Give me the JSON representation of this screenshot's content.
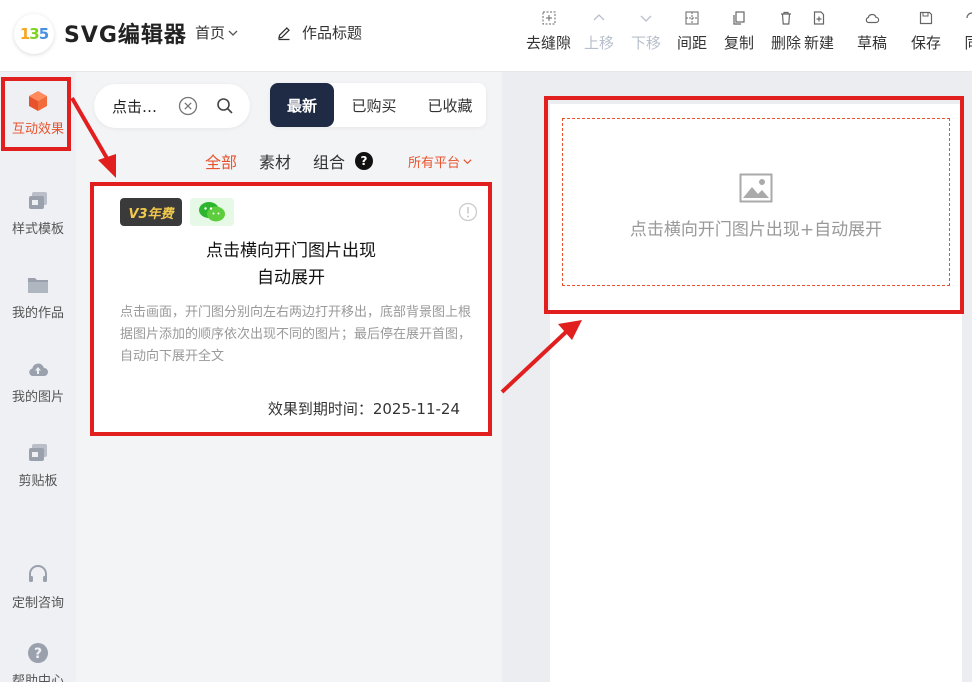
{
  "app": {
    "logo_text": "135",
    "title": "SVG编辑器",
    "home_menu": "首页",
    "work_title": "作品标题"
  },
  "toolbar": [
    {
      "label": "去缝隙",
      "icon": "seam-icon",
      "disabled": false
    },
    {
      "label": "上移",
      "icon": "chevron-up-icon",
      "disabled": true
    },
    {
      "label": "下移",
      "icon": "chevron-down-icon",
      "disabled": true
    },
    {
      "label": "间距",
      "icon": "spacing-icon",
      "disabled": false
    },
    {
      "label": "复制",
      "icon": "copy-icon",
      "disabled": false
    },
    {
      "label": "删除",
      "icon": "trash-icon",
      "disabled": false
    },
    {
      "label": "新建",
      "icon": "new-file-icon",
      "disabled": false
    },
    {
      "label": "草稿",
      "icon": "cloud-icon",
      "disabled": false
    },
    {
      "label": "保存",
      "icon": "save-icon",
      "disabled": false
    },
    {
      "label": "同",
      "icon": "sync-icon",
      "disabled": false
    }
  ],
  "sidebar": {
    "items": [
      {
        "label": "互动效果",
        "icon": "cube-icon",
        "active": true
      },
      {
        "label": "样式模板",
        "icon": "template-icon",
        "active": false
      },
      {
        "label": "我的作品",
        "icon": "folder-icon",
        "active": false
      },
      {
        "label": "我的图片",
        "icon": "cloud-upload-icon",
        "active": false
      },
      {
        "label": "剪贴板",
        "icon": "clipboard-icon",
        "active": false
      },
      {
        "label": "定制咨询",
        "icon": "headset-icon",
        "active": false
      },
      {
        "label": "帮助中心",
        "icon": "help-icon",
        "active": false
      }
    ]
  },
  "search": {
    "value": "点击…"
  },
  "tabs": [
    {
      "label": "最新",
      "active": true
    },
    {
      "label": "已购买",
      "active": false
    },
    {
      "label": "已收藏",
      "active": false
    }
  ],
  "filters": {
    "all": "全部",
    "material": "素材",
    "combo": "组合",
    "combo_help": "?",
    "platform": "所有平台"
  },
  "card": {
    "badge_v3": "V3年费",
    "title_line1": "点击横向开门图片出现",
    "title_line2": "自动展开",
    "description": "点击画面，开门图分别向左右两边打开移出，底部背景图上根据图片添加的顺序依次出现不同的图片；最后停在展开首图，自动向下展开全文",
    "expiry": "效果到期时间：2025-11-24"
  },
  "canvas": {
    "placeholder": "点击横向开门图片出现+自动展开"
  },
  "colors": {
    "accent": "#e8532e",
    "highlight": "#e11f1f",
    "tab_active_bg": "#1f2a44",
    "disabled": "#b8bfcc"
  }
}
